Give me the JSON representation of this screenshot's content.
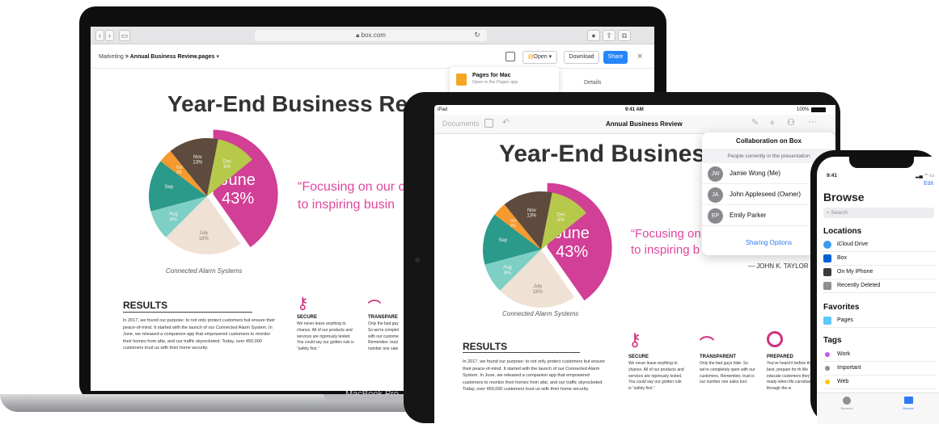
{
  "mac": {
    "label": "MacBook Pro",
    "safari": {
      "url": "box.com"
    },
    "box": {
      "breadcrumb_root": "Marketing",
      "breadcrumb_sep": ">",
      "breadcrumb_file": "Annual Business Review.pages",
      "open_label": "Open",
      "download_label": "Download",
      "share_label": "Share",
      "close_label": "×",
      "dropdown_title": "Pages for Mac",
      "dropdown_sub": "Open in the Pages app",
      "details_tab": "Details"
    },
    "doc": {
      "title": "Year-End Business Rev",
      "quote_line1": "“Focusing on our c",
      "quote_line2": "to inspiring busin",
      "chart_caption": "Connected Alarm Systems",
      "results_heading": "RESULTS",
      "results_text": "In 2017, we found our purpose: to not only protect customers but ensure their peace-of-mind. It started with the launch of our Connected Alarm System. In June, we released a companion app that empowered customers to monitor their homes from afar, and our traffic skyrocketed. Today, over 450,000 customers trust us with their home security.",
      "secure_title": "SECURE",
      "secure_text": "We never leave anything to chance. All of our products and services are rigorously tested. You could say our golden rule is “safety first.”",
      "transparent_title": "TRANSPARE",
      "transparent_text": "Only the bad guy So we're complet with our custome Remember, trust number one sale"
    }
  },
  "ipad": {
    "status_left": "iPad",
    "status_time": "9:41 AM",
    "status_battery": "100%",
    "nav_documents": "Documents",
    "nav_title": "Annual Business Review",
    "doc": {
      "title": "Year-End Business",
      "quote_line1": "“Focusing on",
      "quote_line2": "to inspiring b",
      "attribution": "— JOHN K. TAYLOR",
      "chart_caption": "Connected Alarm Systems",
      "results_heading": "RESULTS",
      "results_text": "In 2017, we found our purpose: to not only protect customers but ensure their peace-of-mind. It started with the launch of our Connected Alarm System. In June, we released a companion app that empowered customers to monitor their homes from afar, and our traffic skyrocketed. Today, over 450,000 customers trust us with their home security.",
      "secure_title": "SECURE",
      "secure_text": "We never leave anything to chance. All of our products and services are rigorously tested. You could say our golden rule is “safety first.”",
      "transparent_title": "TRANSPARENT",
      "transparent_text": "Only the bad guys hide. So we're completely open with our customers. Remember, trust is our number one sales tool.",
      "prepared_title": "PREPARED",
      "prepared_text": "You've heard it before the best, prepare for th We educate customers they're ready when life curveball through the w"
    },
    "collab": {
      "title": "Collaboration on Box",
      "subtitle": "People currently in the presentation",
      "people": [
        {
          "initials": "JW",
          "name": "Jamie Wong (Me)"
        },
        {
          "initials": "JA",
          "name": "John Appleseed (Owner)"
        },
        {
          "initials": "EP",
          "name": "Emily Parker"
        }
      ],
      "sharing": "Sharing Options"
    }
  },
  "iphone": {
    "time": "9:41",
    "edit": "Edit",
    "title": "Browse",
    "search_placeholder": "Search",
    "locations_heading": "Locations",
    "locations": [
      {
        "label": "iCloud Drive",
        "icon": "cloud-icon",
        "color": "#3a9bf0"
      },
      {
        "label": "Box",
        "icon": "box-icon",
        "color": "#0061d5"
      },
      {
        "label": "On My iPhone",
        "icon": "phone-icon",
        "color": "#3a3a3c"
      },
      {
        "label": "Recently Deleted",
        "icon": "trash-icon",
        "color": "#8e8e93"
      }
    ],
    "favorites_heading": "Favorites",
    "favorites": [
      {
        "label": "Pages",
        "icon": "folder-icon",
        "color": "#5ac8fa"
      }
    ],
    "tags_heading": "Tags",
    "tags": [
      {
        "label": "Work",
        "color": "#bf5af2"
      },
      {
        "label": "Important",
        "color": "#8e8e93"
      },
      {
        "label": "Web",
        "color": "#ffcc00"
      }
    ],
    "tab_recents": "Recents",
    "tab_browse": "Browse"
  },
  "chart_data": {
    "type": "pie",
    "labels": [
      "June",
      "July",
      "Aug",
      "Sep",
      "Oct",
      "Nov",
      "Dec"
    ],
    "label_values": [
      "43%",
      "18%",
      "8%",
      "",
      "3%",
      "13%",
      "6%"
    ],
    "colors": [
      "#d13f96",
      "#efe2d5",
      "#7fd0c4",
      "#2b9a8a",
      "#f49a2e",
      "#5e4b3d",
      "#b6c94a"
    ]
  }
}
